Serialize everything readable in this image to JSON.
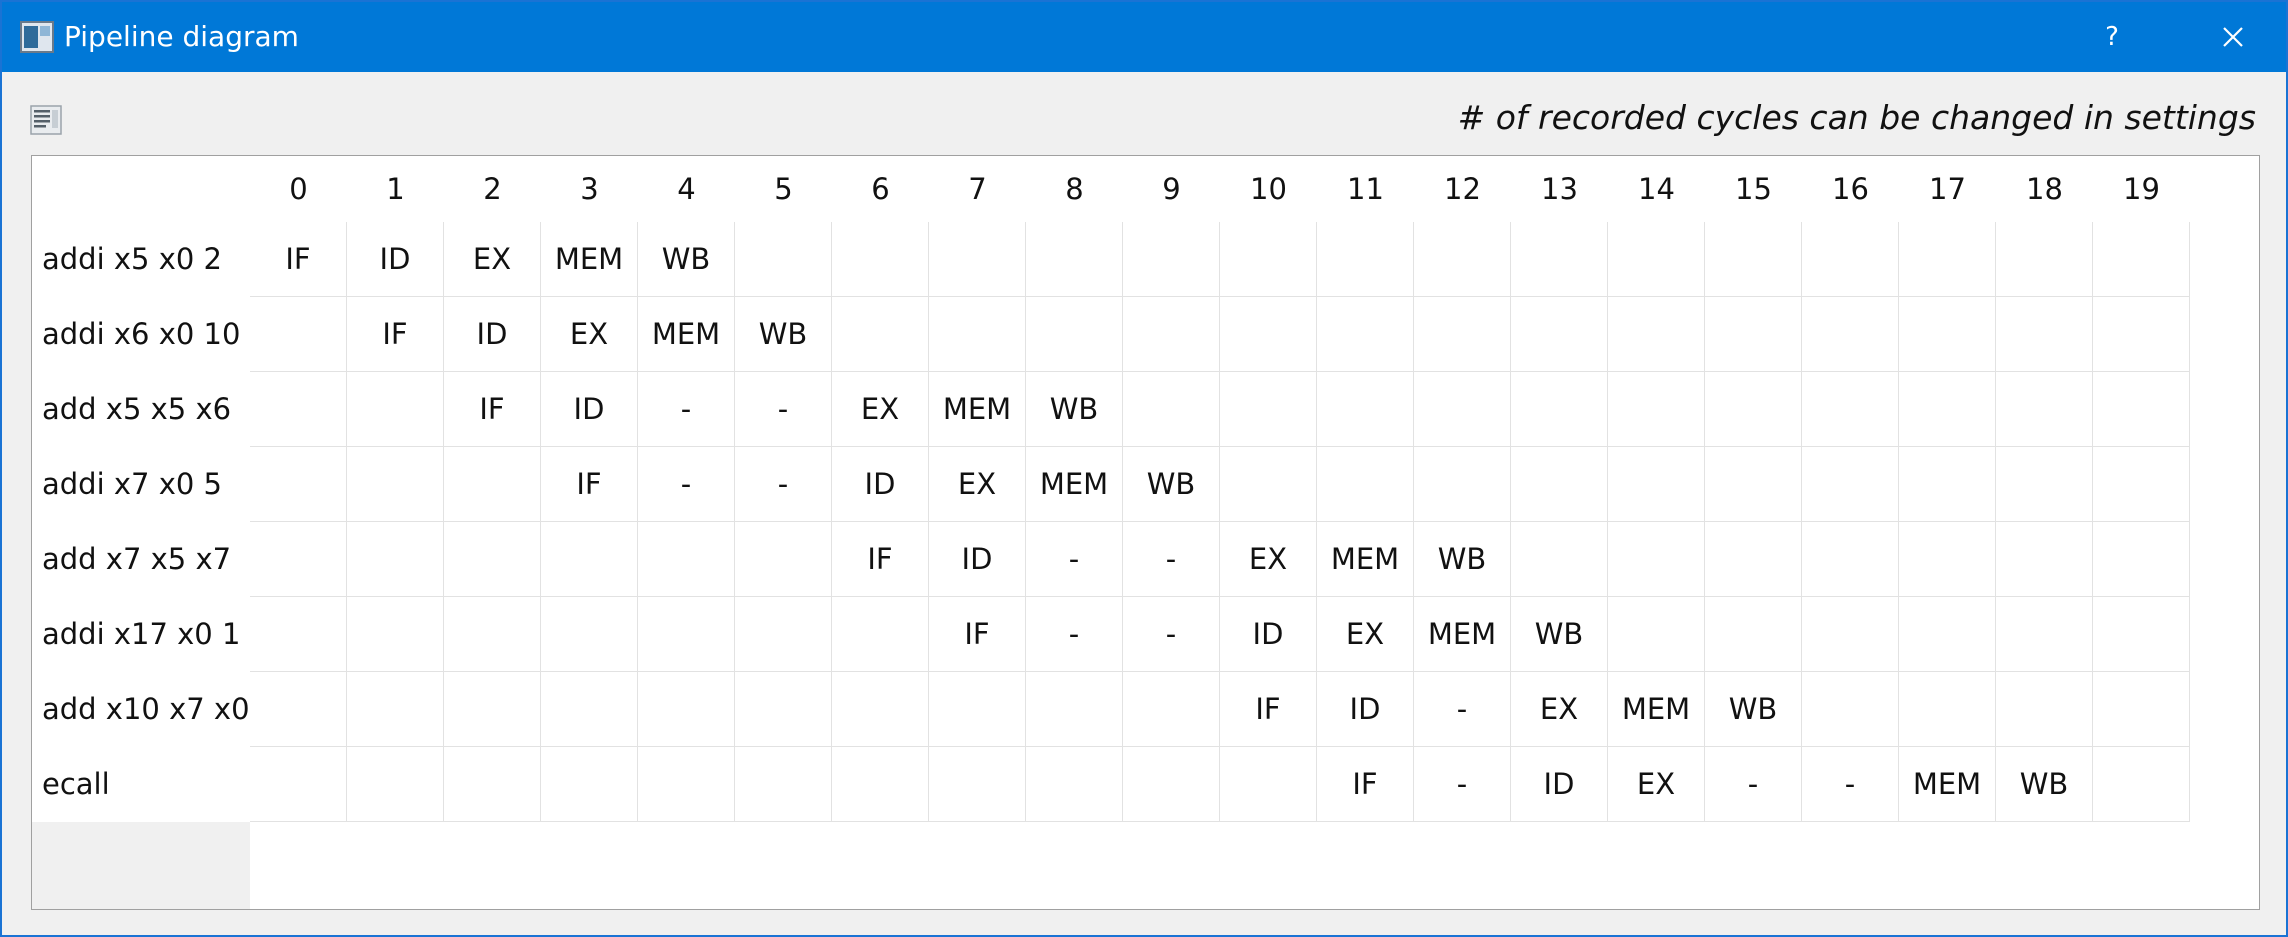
{
  "window": {
    "title": "Pipeline diagram",
    "help_label": "?"
  },
  "toolbar": {
    "icon": "document-list-icon"
  },
  "hint": "# of recorded cycles can be changed in settings",
  "columns": [
    "0",
    "1",
    "2",
    "3",
    "4",
    "5",
    "6",
    "7",
    "8",
    "9",
    "10",
    "11",
    "12",
    "13",
    "14",
    "15",
    "16",
    "17",
    "18",
    "19"
  ],
  "rows": [
    {
      "label": "addi x5 x0 2",
      "cells": [
        "IF",
        "ID",
        "EX",
        "MEM",
        "WB",
        "",
        "",
        "",
        "",
        "",
        "",
        "",
        "",
        "",
        "",
        "",
        "",
        "",
        "",
        ""
      ]
    },
    {
      "label": "addi x6 x0 10",
      "cells": [
        "",
        "IF",
        "ID",
        "EX",
        "MEM",
        "WB",
        "",
        "",
        "",
        "",
        "",
        "",
        "",
        "",
        "",
        "",
        "",
        "",
        "",
        ""
      ]
    },
    {
      "label": "add x5 x5 x6",
      "cells": [
        "",
        "",
        "IF",
        "ID",
        "-",
        "-",
        "EX",
        "MEM",
        "WB",
        "",
        "",
        "",
        "",
        "",
        "",
        "",
        "",
        "",
        "",
        ""
      ]
    },
    {
      "label": "addi x7 x0 5",
      "cells": [
        "",
        "",
        "",
        "IF",
        "-",
        "-",
        "ID",
        "EX",
        "MEM",
        "WB",
        "",
        "",
        "",
        "",
        "",
        "",
        "",
        "",
        "",
        ""
      ]
    },
    {
      "label": "add x7 x5 x7",
      "cells": [
        "",
        "",
        "",
        "",
        "",
        "",
        "IF",
        "ID",
        "-",
        "-",
        "EX",
        "MEM",
        "WB",
        "",
        "",
        "",
        "",
        "",
        "",
        ""
      ]
    },
    {
      "label": "addi x17 x0 1",
      "cells": [
        "",
        "",
        "",
        "",
        "",
        "",
        "",
        "IF",
        "-",
        "-",
        "ID",
        "EX",
        "MEM",
        "WB",
        "",
        "",
        "",
        "",
        "",
        ""
      ]
    },
    {
      "label": "add x10 x7 x0",
      "cells": [
        "",
        "",
        "",
        "",
        "",
        "",
        "",
        "",
        "",
        "",
        "IF",
        "ID",
        "-",
        "EX",
        "MEM",
        "WB",
        "",
        "",
        "",
        ""
      ]
    },
    {
      "label": "ecall",
      "cells": [
        "",
        "",
        "",
        "",
        "",
        "",
        "",
        "",
        "",
        "",
        "",
        "IF",
        "-",
        "ID",
        "EX",
        "-",
        "-",
        "MEM",
        "WB",
        ""
      ]
    }
  ]
}
